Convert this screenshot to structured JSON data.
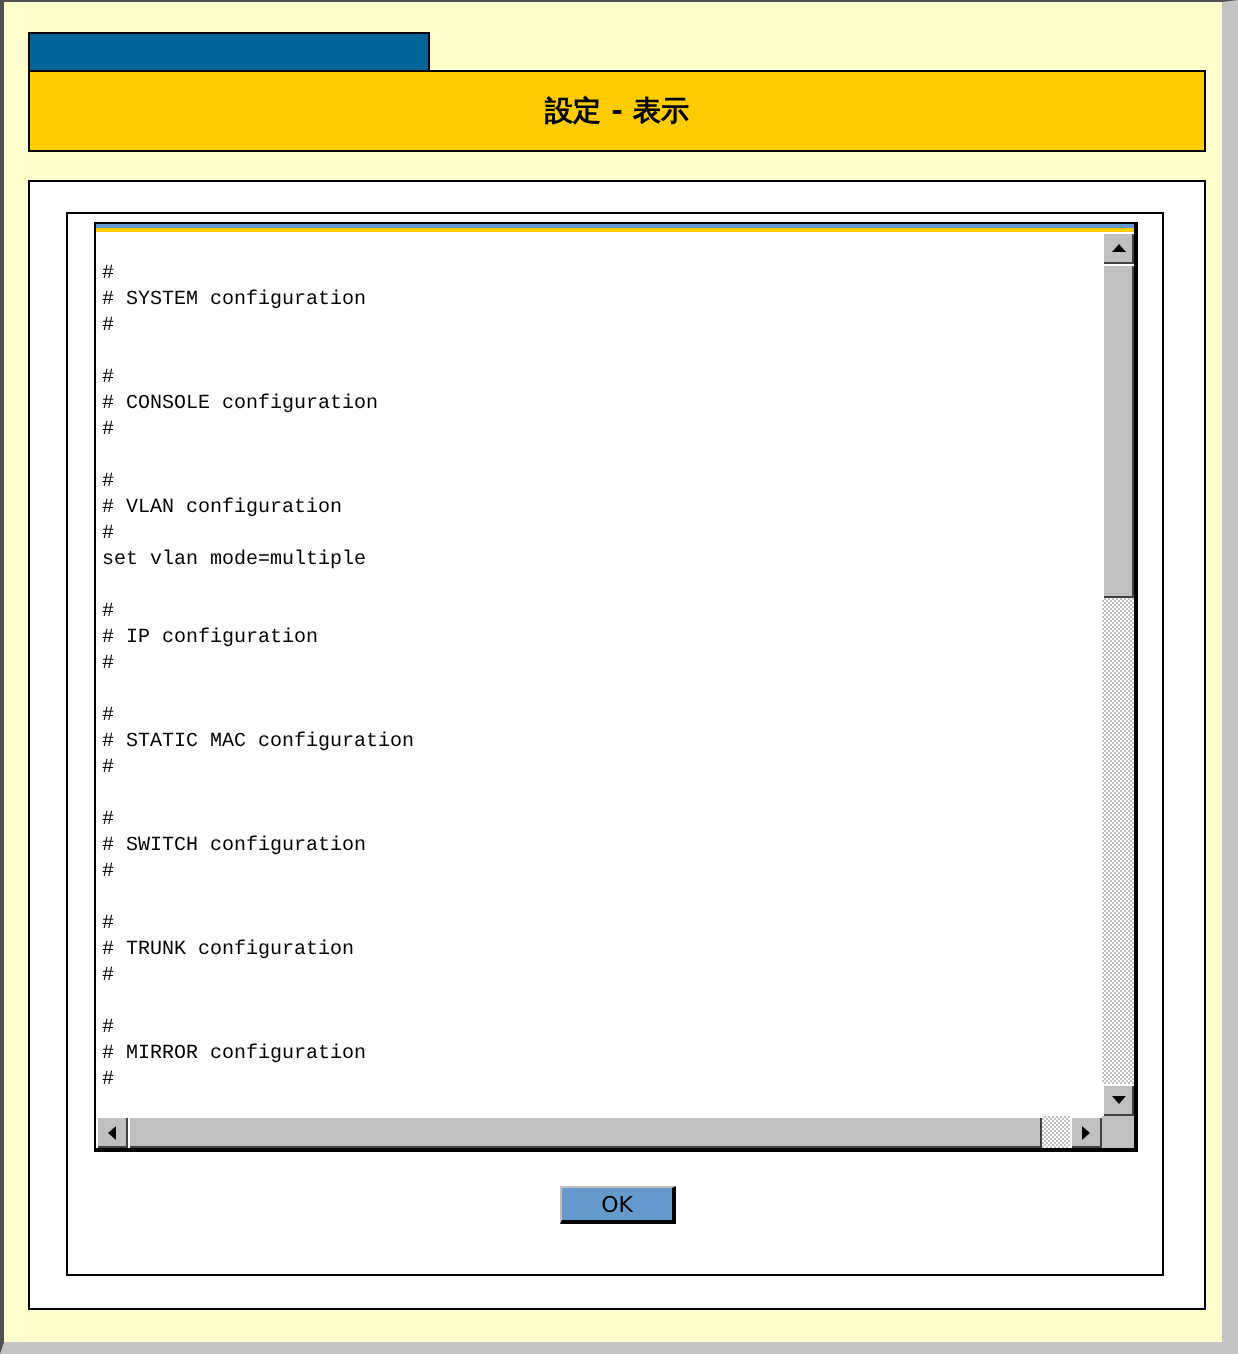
{
  "title": "設定 - 表示",
  "config_text": {
    "blocks": [
      {
        "lines": [
          "#",
          "# SYSTEM configuration",
          "#"
        ]
      },
      {
        "lines": [
          "#",
          "# CONSOLE configuration",
          "#"
        ]
      },
      {
        "lines": [
          "#",
          "# VLAN configuration",
          "#",
          "set vlan mode=multiple"
        ]
      },
      {
        "lines": [
          "#",
          "# IP configuration",
          "#"
        ]
      },
      {
        "lines": [
          "#",
          "# STATIC MAC configuration",
          "#"
        ]
      },
      {
        "lines": [
          "#",
          "# SWITCH configuration",
          "#"
        ]
      },
      {
        "lines": [
          "#",
          "# TRUNK configuration",
          "#"
        ]
      },
      {
        "lines": [
          "#",
          "# MIRROR configuration",
          "#"
        ]
      }
    ]
  },
  "buttons": [
    {
      "label": "OK"
    }
  ]
}
